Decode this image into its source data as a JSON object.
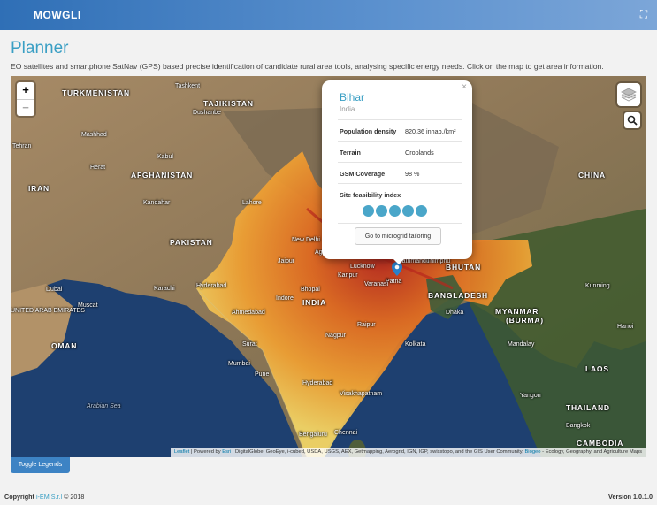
{
  "header": {
    "brand": "MOWGLI",
    "fullscreen_icon": "expand-icon"
  },
  "page": {
    "title": "Planner",
    "description": "EO satellites and smartphone SatNav (GPS) based precise identification of candidate rural area tools, analysing specific energy needs. Click on the map to get area information."
  },
  "map": {
    "zoom_in": "+",
    "zoom_out": "−",
    "labels": {
      "turkmenistan": "TURKMENISTAN",
      "tajikistan": "TAJIKISTAN",
      "afghanistan": "AFGHANISTAN",
      "iran": "IRAN",
      "pakistan": "PAKISTAN",
      "india": "INDIA",
      "china": "CHINA",
      "bangladesh": "BANGLADESH",
      "bhutan": "BHUTAN",
      "myanmar": "MYANMAR",
      "burma": "(BURMA)",
      "oman": "OMAN",
      "laos": "LAOS",
      "thailand": "THAILAND",
      "cambodia": "CAMBODIA",
      "uae": "UNITED ARAB EMIRATES",
      "arabian_sea": "Arabian Sea",
      "kabul": "Kabul",
      "tashkent": "Tashkent",
      "mashhad": "Mashhad",
      "herat": "Herat",
      "tehran": "Tehran",
      "dushanbe": "Dushanbe",
      "kandahar": "Kandahar",
      "karachi": "Karachi",
      "hyderabad_pk": "Hyderabad",
      "lahore": "Lahore",
      "new_delhi": "New Delhi",
      "jaipur": "Jaipur",
      "lucknow": "Lucknow",
      "kanpur": "Kanpur",
      "patna": "Patna",
      "dhaka": "Dhaka",
      "kolkata": "Kolkata",
      "ahmedabad": "Ahmedabad",
      "mumbai": "Mumbai",
      "pune": "Pune",
      "nagpur": "Nagpur",
      "hyderabad_in": "Hyderabad",
      "bengaluru": "Bengaluru",
      "chennai": "Chennai",
      "visakhapatnam": "Visakhapatnam",
      "kunming": "Kunming",
      "mandalay": "Mandalay",
      "yangon": "Yangon",
      "bangkok": "Bangkok",
      "hanoi": "Hanoi",
      "muscat": "Muscat",
      "dubai": "Dubai",
      "surat": "Surat",
      "indore": "Indore",
      "bhopal": "Bhopal",
      "raipur": "Raipur",
      "varanasi": "Varanasi",
      "agra": "Agra",
      "kathmandu": "Kathmandu",
      "thimphu": "Thimphu"
    },
    "attribution": {
      "leaflet": "Leaflet",
      "powered": " | Powered by ",
      "esri": "Esri",
      "sources": " | DigitalGlobe, GeoEye, i-cubed, USDA, USGS, AEX, Getmapping, Aerogrid, IGN, IGP, swisstopo, and the GIS User Community, ",
      "biogeo": "Biogeo",
      "tail": " - Ecology, Geography, and Agriculture Maps"
    }
  },
  "popup": {
    "title": "Bihar",
    "subtitle": "India",
    "close": "×",
    "rows": [
      {
        "label": "Population density",
        "value": "820.36 inhab./km²"
      },
      {
        "label": "Terrain",
        "value": "Croplands"
      },
      {
        "label": "GSM Coverage",
        "value": "98 %"
      }
    ],
    "feasibility_label": "Site feasibility index",
    "feasibility_score": 5,
    "feasibility_max": 5,
    "button": "Go to microgrid tailoring"
  },
  "legend_button": "Toggle Legends",
  "footer": {
    "copyright_prefix": "Copyright ",
    "company": "i-EM S.r.l",
    "year": " © 2018",
    "version": "Version 1.0.1.0"
  }
}
